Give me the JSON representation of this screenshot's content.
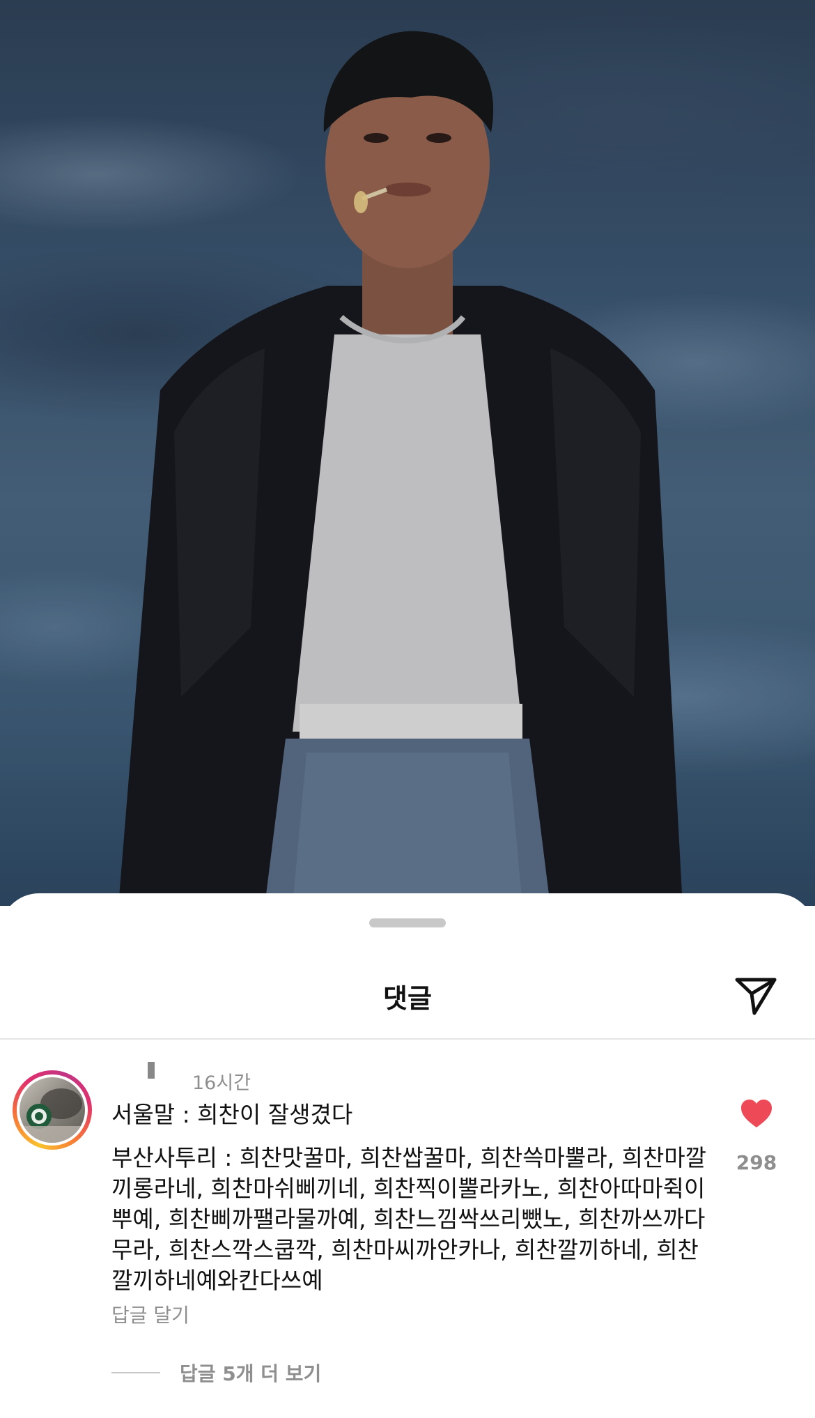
{
  "sheet": {
    "title": "댓글",
    "send_icon": "paper-plane-icon"
  },
  "comment": {
    "time": "16시간",
    "line1": "서울말 : 희찬이 잘생겼다",
    "line2": "부산사투리 : 희찬맛꿀마, 희찬쌉꿀마, 희찬쓱마뿔라, 희찬마깔끼롱라네, 희찬마쉬삐끼네, 희찬찍이뿔라카노, 희찬아따마쥑이뿌예, 희찬삐까팰라물까예, 희찬느낌싹쓰리뺐노, 희찬까쓰까다무라, 희찬스깍스쿱깍, 희찬마씨까안카나, 희찬깔끼하네, 희찬깔끼하네예와칸다쓰예",
    "reply_label": "답글 달기",
    "like_icon": "heart-icon",
    "like_color": "#ed4956",
    "like_count": "298",
    "more_replies": "답글 5개 더 보기"
  }
}
